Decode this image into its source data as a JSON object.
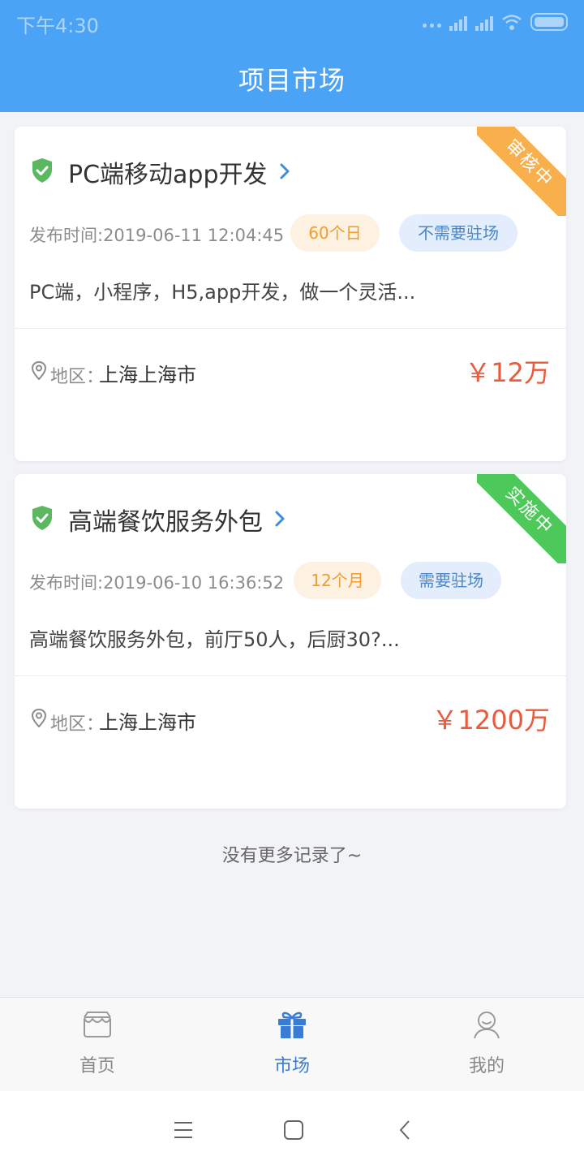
{
  "status_bar": {
    "time": "下午4:30"
  },
  "header": {
    "title": "项目市场"
  },
  "projects": [
    {
      "title": "PC端移动app开发",
      "ribbon": "审核中",
      "publish_time": "发布时间:2019-06-11 12:04:45",
      "duration": "60个日",
      "onsite": "不需要驻场",
      "description": "PC端，小程序，H5,app开发，做一个灵活...",
      "region_label": "地区：",
      "region": "上海上海市",
      "price": "￥12万"
    },
    {
      "title": "高端餐饮服务外包",
      "ribbon": "实施中",
      "publish_time": "发布时间:2019-06-10 16:36:52",
      "duration": "12个月",
      "onsite": "需要驻场",
      "description": "高端餐饮服务外包，前厅50人，后厨30?...",
      "region_label": "地区：",
      "region": "上海上海市",
      "price": "￥1200万"
    }
  ],
  "footer_text": "没有更多记录了~",
  "tabbar": {
    "active": "市场",
    "items": [
      {
        "label": "首页",
        "icon": "storefront-icon"
      },
      {
        "label": "市场",
        "icon": "gift-icon"
      },
      {
        "label": "我的",
        "icon": "user-icon"
      }
    ]
  },
  "colors": {
    "primary": "#4aa3f5",
    "price": "#ea5a3d",
    "ribbon_review": "#f9b04c",
    "ribbon_implementing": "#4dc95a",
    "tab_active": "#3a7bd5"
  }
}
